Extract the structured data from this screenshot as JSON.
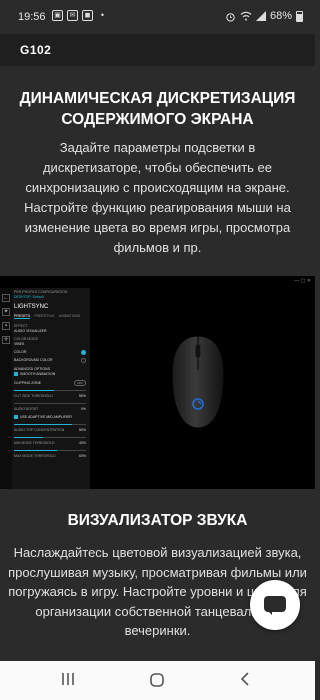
{
  "status_bar": {
    "time": "19:56",
    "notification_icons": [
      "gallery-icon",
      "message-icon",
      "square-icon",
      "dot-icon"
    ],
    "battery_text": "68%",
    "icons": [
      "alarm-icon",
      "wifi-icon",
      "signal-icon",
      "battery-icon"
    ]
  },
  "header": {
    "brand": "G102"
  },
  "hero": {
    "title": "ДИНАМИЧЕСКАЯ ДИСКРЕТИЗАЦИЯ СОДЕРЖИМОГО ЭКРАНА",
    "body": "Задайте параметры подсветки в дискретизаторе, чтобы обеспечить ее синхронизацию с происходящим на экране. Настройте функцию реагирования мыши на изменение цвета во время игры, просмотра фильмов и пр."
  },
  "screenshot": {
    "header_line1": "PER-PROFILE CONFIGURATION",
    "header_line2": "DESKTOP: Default",
    "section": "LIGHTSYNC",
    "tabs": [
      "PRESETS",
      "FREESTYLE",
      "ANIMATIONS"
    ],
    "effect_label": "EFFECT",
    "effect_value": "AUDIO VISUALIZER",
    "color_mode_label": "COLOR MODE",
    "color_mode_value": "VIBES",
    "option_color": "COLOR",
    "option_background": "BACKGROUND COLOR",
    "advanced": "ADVANCED OPTIONS",
    "smooth": "SMOOTH ANIMATION",
    "clipping": "CLIPPING ZONE",
    "clipping_state": "OFF",
    "sliders": [
      {
        "label": "CUT SIDE THRESHOLD",
        "value": "55%",
        "level": 0.55
      },
      {
        "label": "AUDIO BOOST",
        "value": "0%",
        "level": 0.0
      },
      {
        "label": "AUDIO TOP CONCENTRATION",
        "value": "80%",
        "level": 0.8
      },
      {
        "label": "MIN MODE THRESHOLD",
        "value": "40%",
        "level": 0.4
      },
      {
        "label": "MAX MODE THRESHOLD",
        "value": "60%",
        "level": 0.6
      }
    ],
    "use_adaptive": "USE ADAPTIVE MID AMPLIFIER",
    "sync_label": "",
    "colors": {
      "accent": "#1fb6d6"
    }
  },
  "section2": {
    "title": "ВИЗУАЛИЗАТОР ЗВУКА",
    "body": "Наслаждайтесь цветовой визуализацией звука, прослушивая музыку, просматривая фильмы или погружаясь в игру. Настройте уровни и цвета для организации собственной танцевальной вечеринки."
  },
  "chat": {
    "icon": "chat-bubble-icon"
  },
  "navbar": {
    "icons": [
      "recents-icon",
      "home-icon",
      "back-icon"
    ]
  }
}
